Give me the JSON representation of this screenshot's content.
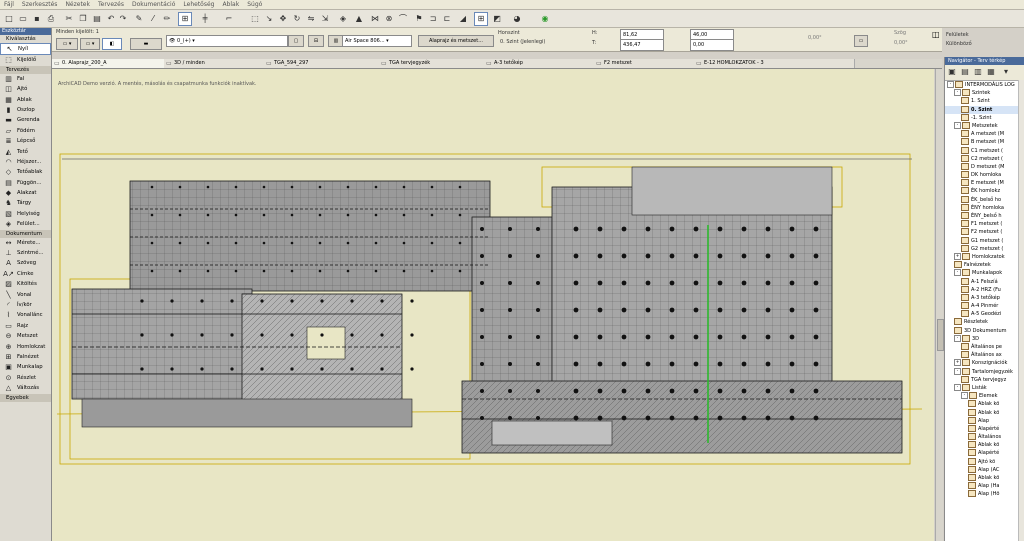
{
  "menu": [
    "Fájl",
    "Szerkesztés",
    "Nézetek",
    "Tervezés",
    "Dokumentáció",
    "Lehetőség",
    "Ablak",
    "Súgó"
  ],
  "leftpanel": {
    "title": "Eszköztár",
    "kivalasztas": "Kiválasztás",
    "sections": {
      "tervezes": "Tervezés",
      "dokumentum": "Dokumentum",
      "egyebek": "Egyebek"
    },
    "items_top": [
      {
        "label": "Nyíl",
        "icon": "arrow-icon",
        "glyph": "↖",
        "selected": true
      },
      {
        "label": "Kijelölő",
        "icon": "marquee-icon",
        "glyph": "⬚",
        "selected": false
      }
    ],
    "items_tervezes": [
      {
        "label": "Fal",
        "icon": "wall-icon",
        "glyph": "▥"
      },
      {
        "label": "Ajtó",
        "icon": "door-icon",
        "glyph": "◫"
      },
      {
        "label": "Ablak",
        "icon": "window-icon",
        "glyph": "▦"
      },
      {
        "label": "Oszlop",
        "icon": "column-icon",
        "glyph": "▮"
      },
      {
        "label": "Gerenda",
        "icon": "beam-icon",
        "glyph": "▬"
      },
      {
        "label": "Födém",
        "icon": "slab-icon",
        "glyph": "▱"
      },
      {
        "label": "Lépcső",
        "icon": "stair-icon",
        "glyph": "≣"
      },
      {
        "label": "Tető",
        "icon": "roof-icon",
        "glyph": "◭"
      },
      {
        "label": "Héjszer...",
        "icon": "shell-icon",
        "glyph": "◠"
      },
      {
        "label": "Tetőablak",
        "icon": "skylight-icon",
        "glyph": "◇"
      },
      {
        "label": "Függön...",
        "icon": "curtain-wall-icon",
        "glyph": "▤"
      },
      {
        "label": "Alakzat",
        "icon": "morph-icon",
        "glyph": "◆"
      },
      {
        "label": "Tárgy",
        "icon": "object-icon",
        "glyph": "♞"
      },
      {
        "label": "Helyiség",
        "icon": "zone-icon",
        "glyph": "▧"
      },
      {
        "label": "Felület...",
        "icon": "mesh-icon",
        "glyph": "◈"
      }
    ],
    "items_dokumentum": [
      {
        "label": "Mérete...",
        "icon": "dimension-icon",
        "glyph": "↔"
      },
      {
        "label": "Szintmé...",
        "icon": "level-dimension-icon",
        "glyph": "⊥"
      },
      {
        "label": "Szöveg",
        "icon": "text-icon",
        "glyph": "A"
      },
      {
        "label": "Címke",
        "icon": "label-icon",
        "glyph": "A↗"
      },
      {
        "label": "Kitöltés",
        "icon": "fill-icon",
        "glyph": "▨"
      },
      {
        "label": "Vonal",
        "icon": "line-icon",
        "glyph": "╲"
      },
      {
        "label": "Ív/kör",
        "icon": "arc-icon",
        "glyph": "◜"
      },
      {
        "label": "Vonallánc",
        "icon": "polyline-icon",
        "glyph": "⌇"
      },
      {
        "label": "Rajz",
        "icon": "drawing-icon",
        "glyph": "▭"
      },
      {
        "label": "Metszet",
        "icon": "section-icon",
        "glyph": "⊖"
      },
      {
        "label": "Homlokzat",
        "icon": "elevation-icon",
        "glyph": "⊕"
      },
      {
        "label": "Falnézet",
        "icon": "interior-elevation-icon",
        "glyph": "⊞"
      },
      {
        "label": "Munkalap",
        "icon": "worksheet-icon",
        "glyph": "▣"
      },
      {
        "label": "Részlet",
        "icon": "detail-icon",
        "glyph": "⊙"
      },
      {
        "label": "Változás",
        "icon": "change-icon",
        "glyph": "△"
      }
    ]
  },
  "infobox": {
    "selection": "Minden kijelölt: 1",
    "layer": "0_(+)",
    "composite": "Air Space 806...",
    "plan_button": "Alaprajz és metszet...",
    "home_story_label": "Honszint",
    "home_story_value": "0. Szint (Jelenlegi)",
    "h_value": "81,62",
    "t_value": "436,47",
    "val1": "46,00",
    "val2": "0,00",
    "angle1": "0,00°",
    "szog_label": "Szög",
    "angle2": "0,00°",
    "feluletek_label": "Felületek",
    "kulonbozo": "Különböző"
  },
  "tabs": [
    {
      "label": "0. Alaprajz_200_A",
      "active": true
    },
    {
      "label": "3D / minden",
      "active": false
    },
    {
      "label": "TGA_594_297",
      "active": false
    },
    {
      "label": "TGA tervjegyzék",
      "active": false
    },
    {
      "label": "A-3 tetőkép",
      "active": false
    },
    {
      "label": "F2 metszet",
      "active": false
    },
    {
      "label": "E-12 HOMLOKZATOK - 3",
      "active": false
    }
  ],
  "canvas": {
    "watermark": "ArchiCAD Demo verzió. A mentés, másolás és csapatmunka funkciók inaktívak."
  },
  "navigator": {
    "title": "Navigátor - Terv térkép",
    "tree": [
      {
        "label": "INTERMODÁLIS LOG",
        "level": 0,
        "exp": "-"
      },
      {
        "label": "Szintek",
        "level": 1,
        "exp": "-"
      },
      {
        "label": "1. Szint",
        "level": 2
      },
      {
        "label": "0. Szint",
        "level": 2,
        "selected": true
      },
      {
        "label": "-1. Szint",
        "level": 2
      },
      {
        "label": "Metszetek",
        "level": 1,
        "exp": "-"
      },
      {
        "label": "A metszet (M",
        "level": 2
      },
      {
        "label": "B metszet (M",
        "level": 2
      },
      {
        "label": "C1 metszet (",
        "level": 2
      },
      {
        "label": "C2 metszet (",
        "level": 2
      },
      {
        "label": "D metszet (M",
        "level": 2
      },
      {
        "label": "DK homloka",
        "level": 2
      },
      {
        "label": "E metszet (M",
        "level": 2
      },
      {
        "label": "ÉK homlokz",
        "level": 2
      },
      {
        "label": "ÉK_belső ho",
        "level": 2
      },
      {
        "label": "ÉNY homloka",
        "level": 2
      },
      {
        "label": "ÉNY_belső h",
        "level": 2
      },
      {
        "label": "F1 metszet (",
        "level": 2
      },
      {
        "label": "F2 metszet (",
        "level": 2
      },
      {
        "label": "G1 metszet (",
        "level": 2
      },
      {
        "label": "G2 metszet (",
        "level": 2
      },
      {
        "label": "Homlokzatok",
        "level": 1,
        "exp": "+"
      },
      {
        "label": "Falnézetek",
        "level": 1
      },
      {
        "label": "Munkalapok",
        "level": 1,
        "exp": "-"
      },
      {
        "label": "A-1 Felszíá",
        "level": 2
      },
      {
        "label": "A-2 HRZ (Fu",
        "level": 2
      },
      {
        "label": "A-3 tetőkép",
        "level": 2
      },
      {
        "label": "A-4 Pinmér",
        "level": 2
      },
      {
        "label": "A-5 Geodézi",
        "level": 2
      },
      {
        "label": "Részletek",
        "level": 1
      },
      {
        "label": "3D Dokumentum",
        "level": 1
      },
      {
        "label": "3D",
        "level": 1,
        "exp": "-"
      },
      {
        "label": "Általános pe",
        "level": 2
      },
      {
        "label": "Általános ax",
        "level": 2
      },
      {
        "label": "Konszignációk",
        "level": 1,
        "exp": "+"
      },
      {
        "label": "Tartalomjegyzék",
        "level": 1,
        "exp": "-"
      },
      {
        "label": "TGA tervjegyz",
        "level": 2
      },
      {
        "label": "Listák",
        "level": 1,
        "exp": "-"
      },
      {
        "label": "Elemek",
        "level": 2,
        "exp": "-"
      },
      {
        "label": "Ablak kö",
        "level": 3
      },
      {
        "label": "Ablak kö",
        "level": 3
      },
      {
        "label": "Alap",
        "level": 3
      },
      {
        "label": "Alapérté",
        "level": 3
      },
      {
        "label": "Általános",
        "level": 3
      },
      {
        "label": "Ablak kö",
        "level": 3
      },
      {
        "label": "Alapérté",
        "level": 3
      },
      {
        "label": "Ajtó kö",
        "level": 3
      },
      {
        "label": "Alap (AC",
        "level": 3
      },
      {
        "label": "Ablak kö",
        "level": 3
      },
      {
        "label": "Alap (Ha",
        "level": 3
      },
      {
        "label": "Alap (Hö",
        "level": 3
      }
    ]
  },
  "colors": {
    "canvas": "#e8e6c5",
    "fill": "#9a9a9a",
    "accent": "#4a6a9a",
    "green": "#2db82d"
  }
}
